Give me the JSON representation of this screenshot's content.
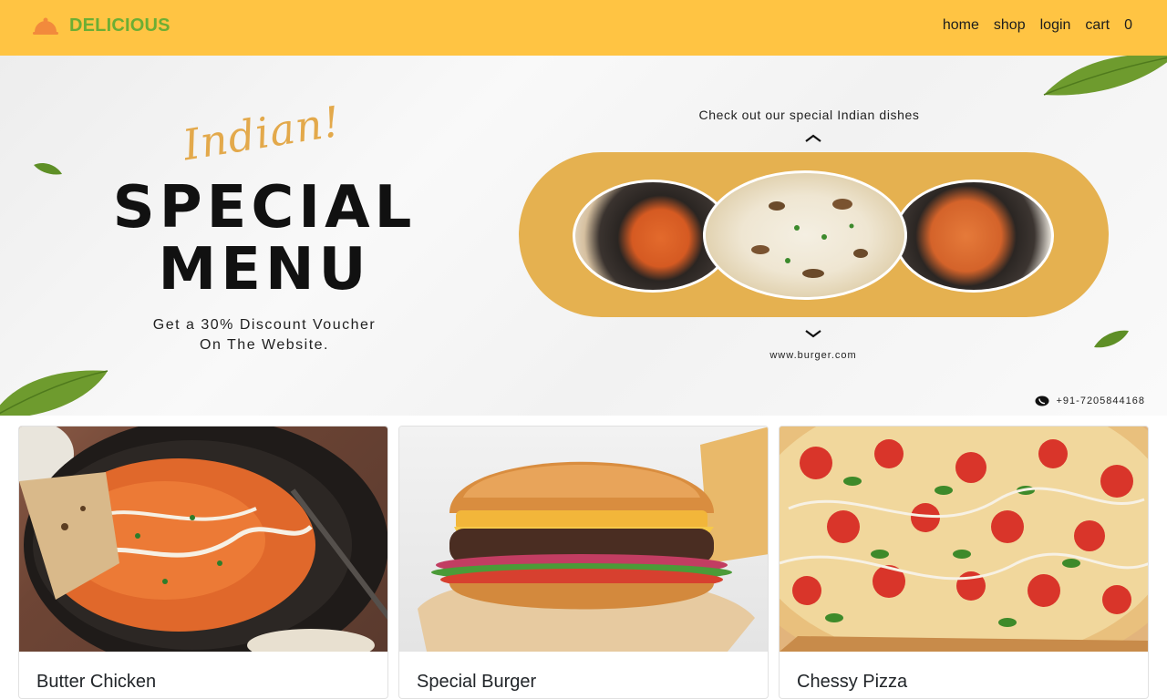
{
  "navbar": {
    "brand": "DELICIOUS",
    "brand_icon": "cloche-icon",
    "links": [
      "home",
      "shop",
      "login",
      "cart",
      "0"
    ],
    "background": "#ffc443",
    "brand_color": "#6cae34"
  },
  "hero": {
    "script_title": "Indian!",
    "title_line1": "SPECIAL",
    "title_line2": "MENU",
    "discount_line1": "Get a 30% Discount Voucher",
    "discount_line2": "On The Website.",
    "tagline": "Check out our special Indian dishes",
    "website": "www.burger.com",
    "phone": "+91-7205844168",
    "accent": "#e5b150"
  },
  "products": [
    {
      "name": "Butter Chicken"
    },
    {
      "name": "Special Burger"
    },
    {
      "name": "Chessy Pizza"
    }
  ]
}
